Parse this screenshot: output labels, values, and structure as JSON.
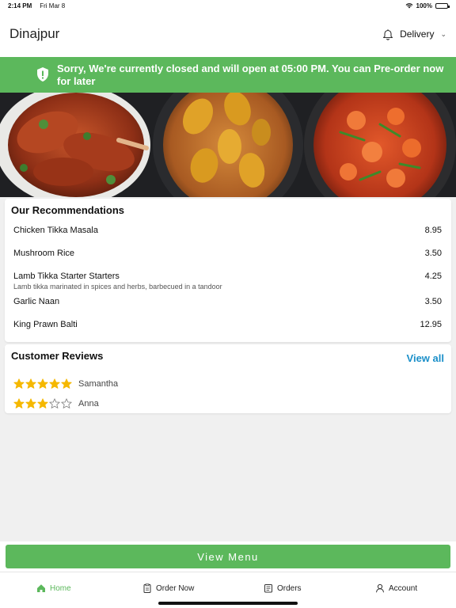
{
  "status_bar": {
    "time": "2:14 PM",
    "date": "Fri Mar 8",
    "battery": "100%",
    "battery_level": 1.0
  },
  "header": {
    "city": "Dinajpur",
    "mode": "Delivery",
    "icons": [
      "bell-icon",
      "chevron-down-icon"
    ]
  },
  "banner": {
    "message": "Sorry, We're currently closed and will open at 05:00 PM. You can Pre-order now for later",
    "icon": "shield-alert-icon"
  },
  "recommendations": {
    "title": "Our Recommendations",
    "items": [
      {
        "name": "Chicken Tikka Masala",
        "price": "8.95",
        "desc": ""
      },
      {
        "name": "Mushroom Rice",
        "price": "3.50",
        "desc": ""
      },
      {
        "name": "Lamb Tikka Starter Starters",
        "price": "4.25",
        "desc": "Lamb tikka marinated in spices and herbs, barbecued in a tandoor"
      },
      {
        "name": "Garlic Naan",
        "price": "3.50",
        "desc": ""
      },
      {
        "name": "King Prawn Balti",
        "price": "12.95",
        "desc": ""
      }
    ]
  },
  "reviews": {
    "title": "Customer Reviews",
    "view_all": "View all",
    "items": [
      {
        "name": "Samantha",
        "rating": 5,
        "max": 5
      },
      {
        "name": "Anna",
        "rating": 3,
        "max": 5
      }
    ]
  },
  "cta": {
    "label": "View Menu"
  },
  "tabs": [
    {
      "label": "Home",
      "icon": "home-icon",
      "active": true
    },
    {
      "label": "Order Now",
      "icon": "clipboard-icon",
      "active": false
    },
    {
      "label": "Orders",
      "icon": "receipt-icon",
      "active": false
    },
    {
      "label": "Account",
      "icon": "user-icon",
      "active": false
    }
  ],
  "colors": {
    "brand_green": "#5cb85c",
    "link_blue": "#1a8fc9",
    "star_gold": "#f5b800"
  }
}
